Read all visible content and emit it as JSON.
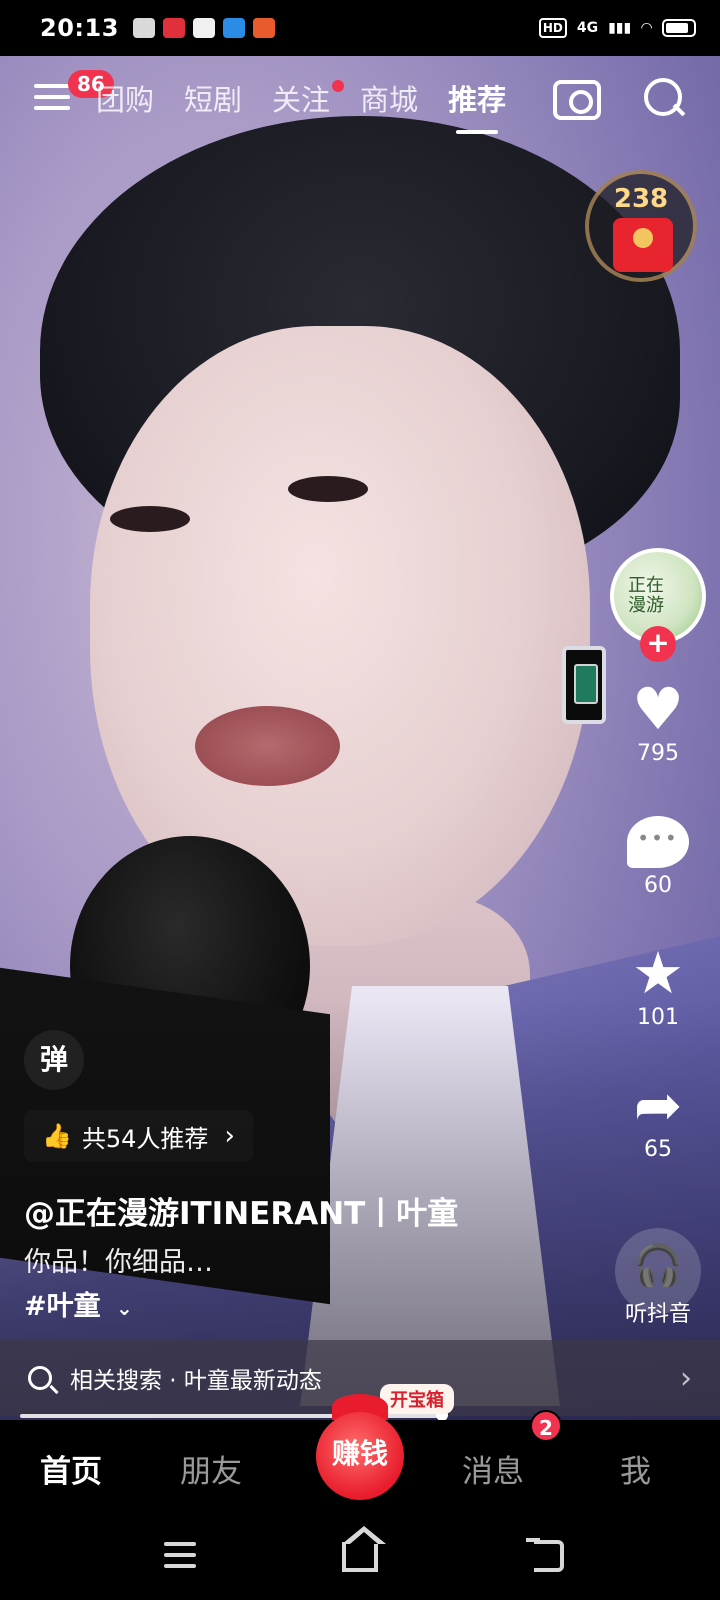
{
  "status_bar": {
    "time": "20:13",
    "hd": "HD",
    "network": "4G",
    "app_icons": [
      {
        "name": "notification-app-icon-1",
        "color": "#ffffff"
      },
      {
        "name": "notification-app-icon-2",
        "color": "#e0303b"
      },
      {
        "name": "notification-app-icon-3",
        "color": "#ffffff"
      },
      {
        "name": "notification-app-icon-4",
        "color": "#2b8ce6"
      },
      {
        "name": "notification-app-icon-5",
        "color": "#e85b2c"
      }
    ]
  },
  "top_nav": {
    "menu_badge": "86",
    "tabs": [
      {
        "label": "团购",
        "active": false,
        "dot": false
      },
      {
        "label": "短剧",
        "active": false,
        "dot": false
      },
      {
        "label": "关注",
        "active": false,
        "dot": true
      },
      {
        "label": "商城",
        "active": false,
        "dot": false
      },
      {
        "label": "推荐",
        "active": true,
        "dot": false
      }
    ],
    "camera_icon": "camera-icon",
    "search_icon": "search-icon"
  },
  "red_packet": {
    "count": "238",
    "icon": "red-envelope-icon"
  },
  "right_rail": {
    "avatar_text": "正在\n漫游",
    "follow_icon": "plus-icon",
    "like_count": "795",
    "comment_count": "60",
    "favorite_count": "101",
    "share_count": "65",
    "listen_label": "听抖音"
  },
  "video_info": {
    "danmu_label": "弹",
    "recommend_text": "共54人推荐",
    "author": "@正在漫游ITINERANT丨叶童",
    "caption": "你品！你细品…",
    "hashtag": "#叶童"
  },
  "related_search": {
    "label": "相关搜索 · 叶童最新动态"
  },
  "progress": {
    "fraction": 0.62,
    "treasure_label": "开宝箱"
  },
  "bottom_nav": {
    "home": "首页",
    "friends": "朋友",
    "earn": "赚钱",
    "messages": "消息",
    "messages_badge": "2",
    "me": "我"
  },
  "colors": {
    "accent_red": "#f2334f",
    "earn_red": "#e81c2c"
  }
}
